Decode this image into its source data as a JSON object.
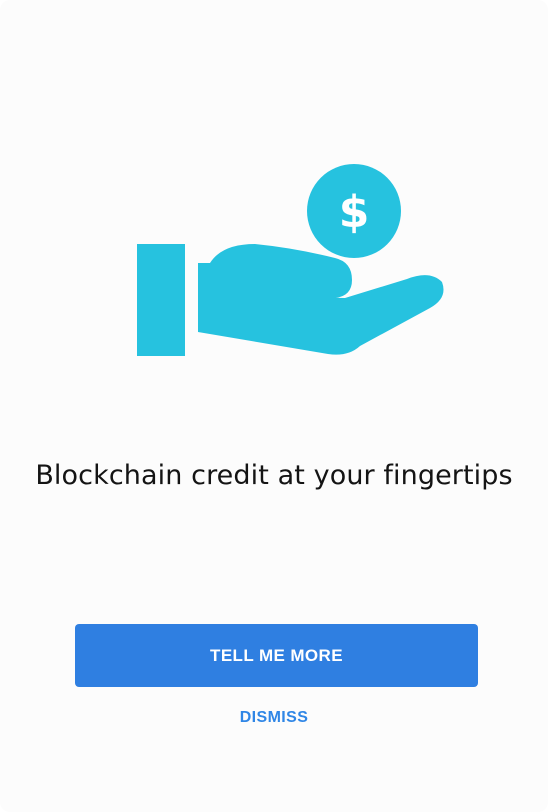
{
  "illustration": {
    "icon": "hand-holding-dollar-icon",
    "coin_symbol": "$",
    "color": "#26c2df"
  },
  "headline": "Blockchain credit at your fingertips",
  "actions": {
    "primary_label": "TELL ME MORE",
    "secondary_label": "DISMISS",
    "primary_color": "#2f7fe1",
    "link_color": "#2f86e6"
  }
}
